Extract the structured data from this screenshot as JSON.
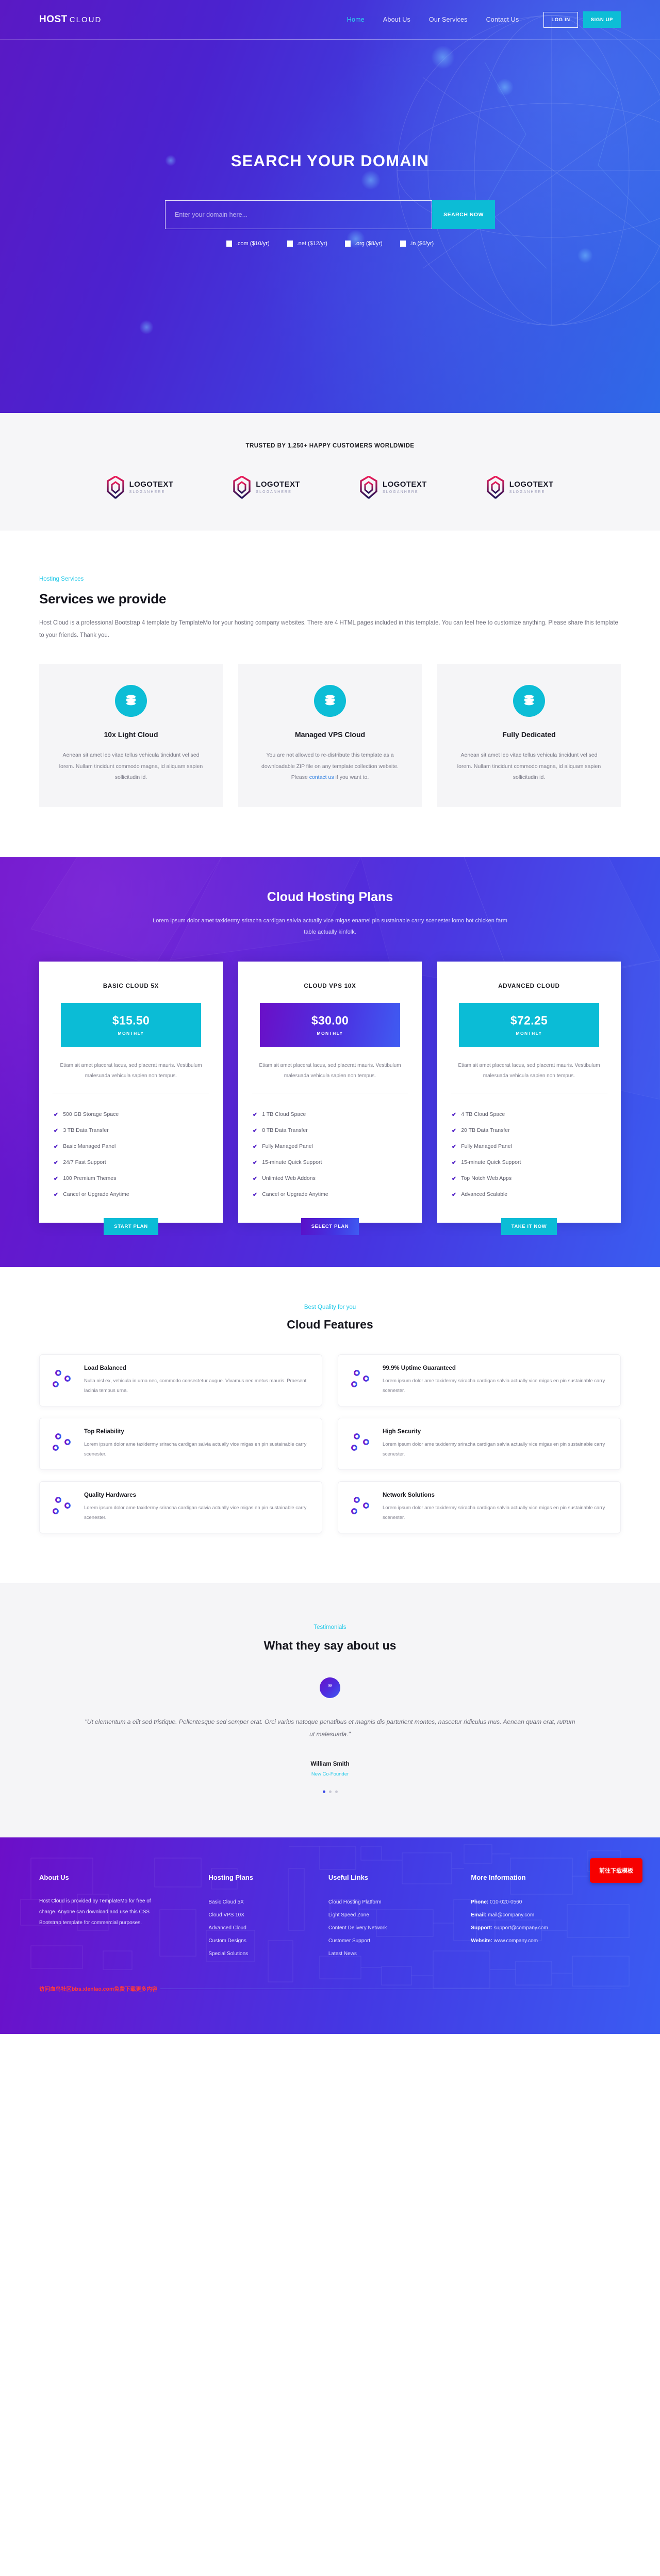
{
  "brand": {
    "name": "HOST",
    "suffix": "CLOUD"
  },
  "nav": {
    "links": [
      {
        "label": "Home",
        "active": true
      },
      {
        "label": "About Us",
        "active": false
      },
      {
        "label": "Our Services",
        "active": false
      },
      {
        "label": "Contact Us",
        "active": false
      }
    ],
    "login_label": "LOG IN",
    "signup_label": "SIGN UP"
  },
  "hero": {
    "title": "SEARCH YOUR DOMAIN",
    "search_placeholder": "Enter your domain here...",
    "search_value": "",
    "search_button": "SEARCH NOW",
    "tlds": [
      {
        "label": ".com ($10/yr)"
      },
      {
        "label": ".net ($12/yr)"
      },
      {
        "label": ".org ($8/yr)"
      },
      {
        "label": ".in ($6/yr)"
      }
    ]
  },
  "trusted": {
    "title": "TRUSTED BY 1,250+ HAPPY CUSTOMERS WORLDWIDE",
    "logos": [
      {
        "name": "LOGOTEXT",
        "slogan": "SLOGANHERE"
      },
      {
        "name": "LOGOTEXT",
        "slogan": "SLOGANHERE"
      },
      {
        "name": "LOGOTEXT",
        "slogan": "SLOGANHERE"
      },
      {
        "name": "LOGOTEXT",
        "slogan": "SLOGANHERE"
      }
    ]
  },
  "services": {
    "eyebrow": "Hosting Services",
    "heading": "Services we provide",
    "paragraph": "Host Cloud is a professional Bootstrap 4 template by TemplateMo for your hosting company websites. There are 4 HTML pages included in this template. You can feel free to customize anything. Please share this template to your friends. Thank you.",
    "cards": [
      {
        "icon": "database-icon",
        "title": "10x Light Cloud",
        "desc": "Aenean sit amet leo vitae tellus vehicula tincidunt vel sed lorem. Nullam tincidunt commodo magna, id aliquam sapien sollicitudin id.",
        "link": "",
        "desc_tail": ""
      },
      {
        "icon": "database-icon",
        "title": "Managed VPS Cloud",
        "desc": "You are not allowed to re-distribute this template as a downloadable ZIP file on any template collection website. Please ",
        "link": "contact us",
        "desc_tail": " if you want to."
      },
      {
        "icon": "database-icon",
        "title": "Fully Dedicated",
        "desc": "Aenean sit amet leo vitae tellus vehicula tincidunt vel sed lorem. Nullam tincidunt commodo magna, id aliquam sapien sollicitudin id.",
        "link": "",
        "desc_tail": ""
      }
    ]
  },
  "pricing": {
    "heading": "Cloud Hosting Plans",
    "paragraph": "Lorem ipsum dolor amet taxidermy sriracha cardigan salvia actually vice migas enamel pin sustainable carry scenester lomo hot chicken farm table actually kinfolk.",
    "plans": [
      {
        "name": "BASIC CLOUD 5X",
        "price": "$15.50",
        "period": "MONTHLY",
        "style": "cyan",
        "desc": "Etiam sit amet placerat lacus, sed placerat mauris. Vestibulum malesuada vehicula sapien non tempus.",
        "features": [
          "500 GB Storage Space",
          "3 TB Data Transfer",
          "Basic Managed Panel",
          "24/7 Fast Support",
          "100 Premium Themes",
          "Cancel or Upgrade Anytime"
        ],
        "button": "START PLAN"
      },
      {
        "name": "CLOUD VPS 10X",
        "price": "$30.00",
        "period": "MONTHLY",
        "style": "grad",
        "desc": "Etiam sit amet placerat lacus, sed placerat mauris. Vestibulum malesuada vehicula sapien non tempus.",
        "features": [
          "1 TB Cloud Space",
          "8 TB Data Transfer",
          "Fully Managed Panel",
          "15-minute Quick Support",
          "Unlimted Web Addons",
          "Cancel or Upgrade Anytime"
        ],
        "button": "SELECT PLAN"
      },
      {
        "name": "ADVANCED CLOUD",
        "price": "$72.25",
        "period": "MONTHLY",
        "style": "cyan",
        "desc": "Etiam sit amet placerat lacus, sed placerat mauris. Vestibulum malesuada vehicula sapien non tempus.",
        "features": [
          "4 TB Cloud Space",
          "20 TB Data Transfer",
          "Fully Managed Panel",
          "15-minute Quick Support",
          "Top Notch Web Apps",
          "Advanced Scalable"
        ],
        "button": "TAKE IT NOW"
      }
    ]
  },
  "features": {
    "eyebrow": "Best Quality for you",
    "heading": "Cloud Features",
    "items": [
      {
        "icon": "sliders-icon",
        "title": "Load Balanced",
        "desc": "Nulla nisl ex, vehicula in urna nec, commodo consectetur augue. Vivamus nec metus mauris. Praesent lacinia tempus urna."
      },
      {
        "icon": "sliders-icon",
        "title": "99.9% Uptime Guaranteed",
        "desc": "Lorem ipsum dolor ame taxidermy sriracha cardigan salvia actually vice migas en pin sustainable carry scenester."
      },
      {
        "icon": "sliders-icon",
        "title": "Top Reliability",
        "desc": "Lorem ipsum dolor ame taxidermy sriracha cardigan salvia actually vice migas en pin sustainable carry scenester."
      },
      {
        "icon": "sliders-icon",
        "title": "High Security",
        "desc": "Lorem ipsum dolor ame taxidermy sriracha cardigan salvia actually vice migas en pin sustainable carry scenester."
      },
      {
        "icon": "sliders-icon",
        "title": "Quality Hardwares",
        "desc": "Lorem ipsum dolor ame taxidermy sriracha cardigan salvia actually vice migas en pin sustainable carry scenester."
      },
      {
        "icon": "sliders-icon",
        "title": "Network Solutions",
        "desc": "Lorem ipsum dolor ame taxidermy sriracha cardigan salvia actually vice migas en pin sustainable carry scenester."
      }
    ]
  },
  "testimonials": {
    "eyebrow": "Testimonials",
    "heading": "What they say about us",
    "quote_mark": "”",
    "quote": "\"Ut elementum a elit sed tristique. Pellentesque sed semper erat. Orci varius natoque penatibus et magnis dis parturient montes, nascetur ridiculus mus. Aenean quam erat, rutrum ut malesuada.\"",
    "author": "William Smith",
    "role": "New Co-Founder",
    "dots": 3,
    "active_dot": 0
  },
  "footer": {
    "about": {
      "title": "About Us",
      "text": "Host Cloud is provided by TemplateMo for free of charge. Anyone can download and use this CSS Bootstrap template for commercial purposes."
    },
    "plans": {
      "title": "Hosting Plans",
      "items": [
        "Basic Cloud 5X",
        "Cloud VPS 10X",
        "Advanced Cloud",
        "Custom Designs",
        "Special Solutions"
      ]
    },
    "links": {
      "title": "Useful Links",
      "items": [
        "Cloud Hosting Platform",
        "Light Speed Zone",
        "Content Delivery Network",
        "Customer Support",
        "Latest News"
      ]
    },
    "info": {
      "title": "More Information",
      "items": [
        {
          "label": "Phone:",
          "value": "010-020-0560"
        },
        {
          "label": "Email:",
          "value": "mail@company.com"
        },
        {
          "label": "Support:",
          "value": "support@company.com"
        },
        {
          "label": "Website:",
          "value": "www.company.com"
        }
      ]
    },
    "copyright": "访问血鸟社区bbs.xlenlao.com免费下载更多内容",
    "download_button": "前往下载模板"
  },
  "colors": {
    "accent_cyan": "#0dbdd6",
    "accent_purple": "#5a19c4",
    "accent_blue": "#3a5cf2",
    "link_blue": "#2f7fe0",
    "red": "#f70000"
  }
}
